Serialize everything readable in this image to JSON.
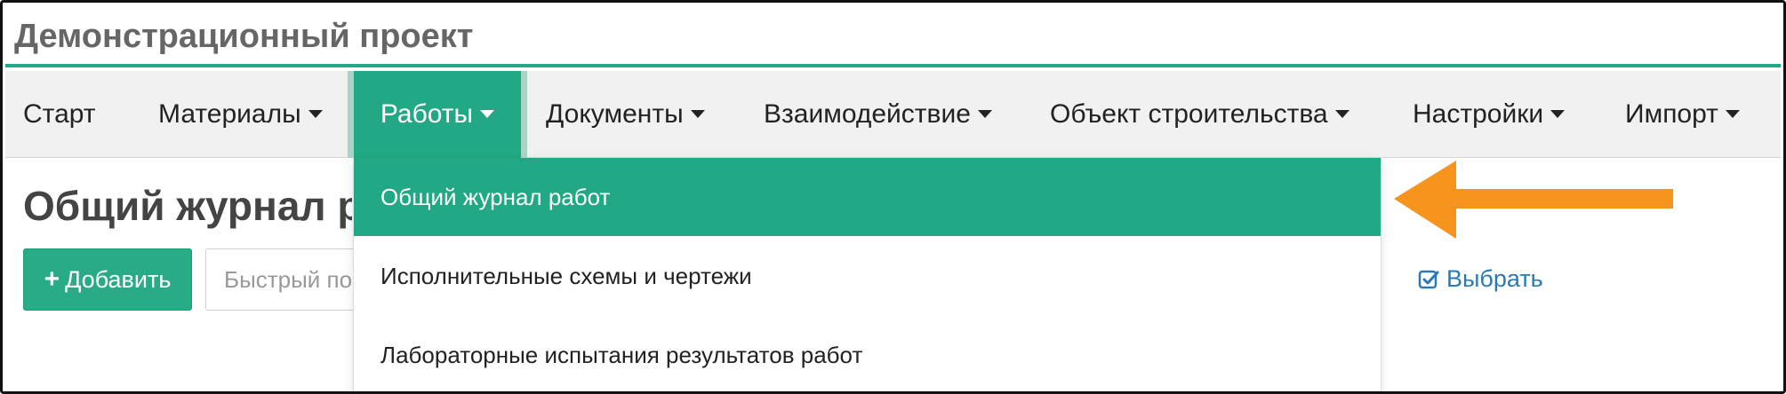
{
  "app": {
    "title": "Демонстрационный проект"
  },
  "navbar": {
    "items": [
      {
        "label": "Старт",
        "has_caret": false
      },
      {
        "label": "Материалы",
        "has_caret": true
      },
      {
        "label": "Работы",
        "has_caret": true,
        "active": true
      },
      {
        "label": "Документы",
        "has_caret": true
      },
      {
        "label": "Взаимодействие",
        "has_caret": true
      },
      {
        "label": "Объект строительства",
        "has_caret": true
      },
      {
        "label": "Настройки",
        "has_caret": true
      },
      {
        "label": "Импорт",
        "has_caret": true
      }
    ]
  },
  "page": {
    "title": "Общий журнал работ",
    "add_button": "Добавить",
    "search_placeholder": "Быстрый поиск",
    "select_link": "Выбрать"
  },
  "dropdown": {
    "items": [
      {
        "label": "Общий журнал работ",
        "active": true
      },
      {
        "label": "Исполнительные схемы и чертежи",
        "active": false
      },
      {
        "label": "Лабораторные испытания результатов работ",
        "active": false
      }
    ]
  },
  "colors": {
    "accent": "#22a884",
    "annotation_arrow": "#f7941d",
    "link": "#2a7ab8"
  },
  "icons": {
    "add": "plus-icon",
    "select": "check-square-icon",
    "caret": "caret-down-icon",
    "annotation": "arrow-left-icon"
  }
}
